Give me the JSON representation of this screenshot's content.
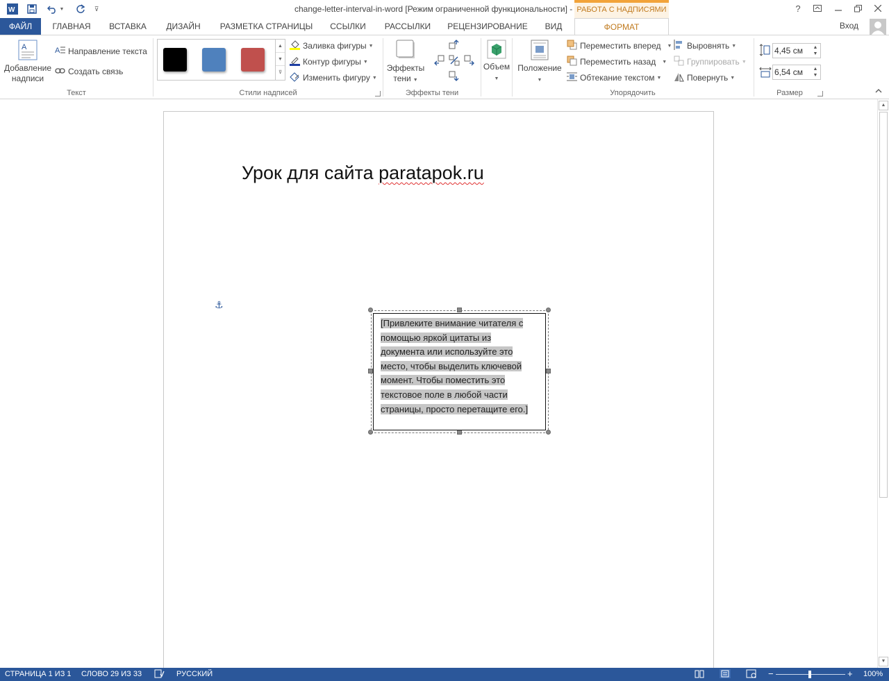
{
  "window": {
    "title": "change-letter-interval-in-word [Режим ограниченной функциональности] - Word",
    "context_tab_group": "РАБОТА С НАДПИСЯМИ",
    "help": "?",
    "sign_in": "Вход"
  },
  "tabs": [
    {
      "label": "ФАЙЛ"
    },
    {
      "label": "ГЛАВНАЯ"
    },
    {
      "label": "ВСТАВКА"
    },
    {
      "label": "ДИЗАЙН"
    },
    {
      "label": "РАЗМЕТКА СТРАНИЦЫ"
    },
    {
      "label": "ССЫЛКИ"
    },
    {
      "label": "РАССЫЛКИ"
    },
    {
      "label": "РЕЦЕНЗИРОВАНИЕ"
    },
    {
      "label": "ВИД"
    },
    {
      "label": "ФОРМАТ"
    }
  ],
  "ribbon": {
    "text_group": {
      "label": "Текст",
      "add_caption_line1": "Добавление",
      "add_caption_line2": "надписи",
      "text_direction": "Направление текста",
      "create_link": "Создать связь"
    },
    "styles_group": {
      "label": "Стили надписей",
      "shape_fill": "Заливка фигуры",
      "shape_outline": "Контур фигуры",
      "change_shape": "Изменить фигуру",
      "swatch_colors": [
        "#000000",
        "#4f81bd",
        "#c0504d"
      ]
    },
    "shadow_group": {
      "label": "Эффекты тени",
      "shadow_effects_line1": "Эффекты",
      "shadow_effects_line2": "тени"
    },
    "volume_group": {
      "volume": "Объем"
    },
    "arrange_group": {
      "label": "Упорядочить",
      "position": "Положение",
      "bring_forward": "Переместить вперед",
      "send_backward": "Переместить назад",
      "wrap_text": "Обтекание текстом",
      "align": "Выровнять",
      "group": "Группировать",
      "rotate": "Повернуть"
    },
    "size_group": {
      "label": "Размер",
      "height": "4,45 см",
      "width": "6,54 см"
    }
  },
  "document": {
    "title_prefix": "Урок для сайта ",
    "title_site": "paratapok.ru",
    "textbox_text": "[Привлеките внимание читателя с помощью яркой цитаты из документа или используйте это место, чтобы выделить ключевой момент. Чтобы поместить это текстовое поле в любой части страницы, просто перетащите его.]"
  },
  "status": {
    "page": "СТРАНИЦА 1 ИЗ 1",
    "words": "СЛОВО 29 ИЗ 33",
    "language": "РУССКИЙ",
    "zoom": "100%",
    "zoom_level_percent": 100
  },
  "colors": {
    "accent": "#2b579a",
    "context_tab": "#f2a33a"
  }
}
